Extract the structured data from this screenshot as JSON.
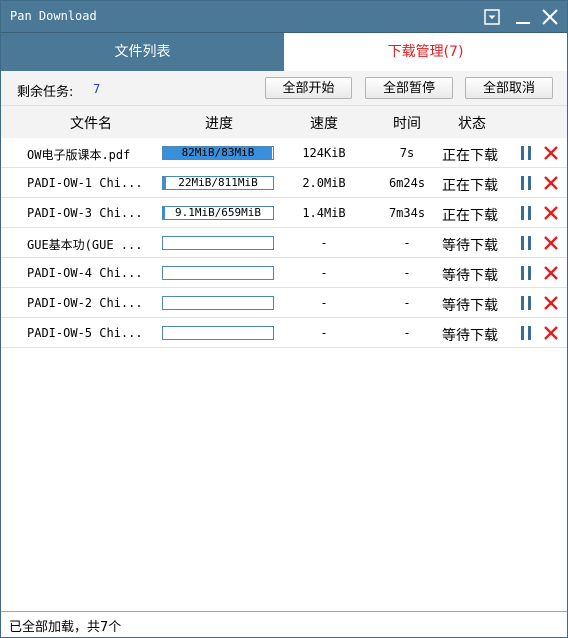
{
  "window": {
    "title": "Pan Download"
  },
  "tabs": {
    "files": "文件列表",
    "downloads": "下载管理(7)"
  },
  "toolbar": {
    "remaining_label": "剩余任务:",
    "remaining_count": "7",
    "start_all": "全部开始",
    "pause_all": "全部暂停",
    "cancel_all": "全部取消"
  },
  "columns": {
    "name": "文件名",
    "progress": "进度",
    "speed": "速度",
    "time": "时间",
    "status": "状态"
  },
  "rows": [
    {
      "name": "OW电子版课本.pdf",
      "progress_text": "82MiB/83MiB",
      "progress": 0.988,
      "speed": "124KiB",
      "time": "7s",
      "status": "正在下载"
    },
    {
      "name": "PADI-OW-1  Chi...",
      "progress_text": "22MiB/811MiB",
      "progress": 0.027,
      "speed": "2.0MiB",
      "time": "6m24s",
      "status": "正在下载"
    },
    {
      "name": "PADI-OW-3  Chi...",
      "progress_text": "9.1MiB/659MiB",
      "progress": 0.014,
      "speed": "1.4MiB",
      "time": "7m34s",
      "status": "正在下载"
    },
    {
      "name": "GUE基本功(GUE ...",
      "progress_text": "",
      "progress": 0,
      "speed": "-",
      "time": "-",
      "status": "等待下载"
    },
    {
      "name": "PADI-OW-4  Chi...",
      "progress_text": "",
      "progress": 0,
      "speed": "-",
      "time": "-",
      "status": "等待下载"
    },
    {
      "name": "PADI-OW-2  Chi...",
      "progress_text": "",
      "progress": 0,
      "speed": "-",
      "time": "-",
      "status": "等待下载"
    },
    {
      "name": "PADI-OW-5  Chi...",
      "progress_text": "",
      "progress": 0,
      "speed": "-",
      "time": "-",
      "status": "等待下载"
    }
  ],
  "statusbar": {
    "text": "已全部加载，共7个"
  },
  "colors": {
    "titlebar": "#4a7896",
    "accent_red": "#e02020",
    "progress_fill": "#3a8fd9",
    "pause_icon": "#3a6d95"
  }
}
